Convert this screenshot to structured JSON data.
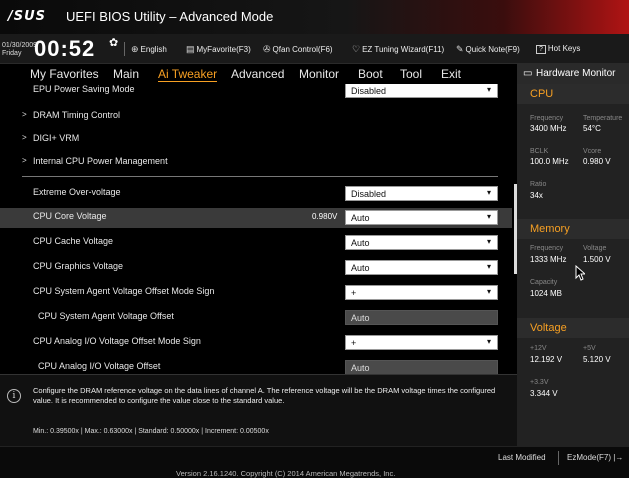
{
  "titlebar": {
    "logo": "/SUS",
    "title": "UEFI BIOS Utility – Advanced Mode"
  },
  "statusbar": {
    "date": "01/30/2009",
    "day": "Friday",
    "time": "00:52",
    "items": [
      {
        "icon": "globe-icon",
        "label": "English"
      },
      {
        "icon": "favorite-icon",
        "label": "MyFavorite(F3)"
      },
      {
        "icon": "fan-icon",
        "label": "Qfan Control(F6)"
      },
      {
        "icon": "bulb-icon",
        "label": "EZ Tuning Wizard(F11)"
      },
      {
        "icon": "note-icon",
        "label": "Quick Note(F9)"
      },
      {
        "icon": "help-icon",
        "label": "Hot Keys"
      }
    ]
  },
  "menu": {
    "items": [
      "My Favorites",
      "Main",
      "Ai Tweaker",
      "Advanced",
      "Monitor",
      "Boot",
      "Tool",
      "Exit"
    ],
    "active": "Ai Tweaker"
  },
  "settings": {
    "epu": {
      "label": "EPU Power Saving Mode",
      "value": "Disabled"
    },
    "dram_timing": "DRAM Timing Control",
    "digi_vrm": "DIGI+ VRM",
    "internal_cpu": "Internal CPU Power Management",
    "extreme_ov": {
      "label": "Extreme Over-voltage",
      "value": "Disabled"
    },
    "cpu_core": {
      "label": "CPU Core Voltage",
      "reading": "0.980V",
      "value": "Auto"
    },
    "cpu_cache": {
      "label": "CPU Cache Voltage",
      "value": "Auto"
    },
    "cpu_graphics": {
      "label": "CPU Graphics Voltage",
      "value": "Auto"
    },
    "sa_sign": {
      "label": "CPU System Agent Voltage Offset Mode Sign",
      "value": "+"
    },
    "sa_offset": {
      "label": "CPU System Agent Voltage Offset",
      "value": "Auto"
    },
    "aio_sign": {
      "label": "CPU Analog I/O Voltage Offset Mode Sign",
      "value": "+"
    },
    "aio_offset": {
      "label": "CPU Analog I/O Voltage Offset",
      "value": "Auto"
    }
  },
  "hardware_monitor": {
    "title": "Hardware Monitor",
    "cpu": {
      "title": "CPU",
      "frequency_label": "Frequency",
      "frequency": "3400 MHz",
      "temperature_label": "Temperature",
      "temperature": "54°C",
      "bclk_label": "BCLK",
      "bclk": "100.0 MHz",
      "vcore_label": "Vcore",
      "vcore": "0.980 V",
      "ratio_label": "Ratio",
      "ratio": "34x"
    },
    "memory": {
      "title": "Memory",
      "frequency_label": "Frequency",
      "frequency": "1333 MHz",
      "voltage_label": "Voltage",
      "voltage": "1.500 V",
      "capacity_label": "Capacity",
      "capacity": "1024 MB"
    },
    "voltage": {
      "title": "Voltage",
      "v12_label": "+12V",
      "v12": "12.192 V",
      "v5_label": "+5V",
      "v5": "5.120 V",
      "v33_label": "+3.3V",
      "v33": "3.344 V"
    }
  },
  "help": {
    "text": "Configure the DRAM reference voltage on the data lines of channel A. The reference voltage will be the DRAM voltage times the configured value. It is recommended to configure the value close to the standard value.",
    "range": "Min.: 0.39500x   |   Max.: 0.63000x   |   Standard: 0.50000x   |   Increment: 0.00500x"
  },
  "footer": {
    "last_modified": "Last Modified",
    "ezmode": "EzMode(F7)",
    "version": "Version 2.16.1240. Copyright (C) 2014 American Megatrends, Inc."
  }
}
